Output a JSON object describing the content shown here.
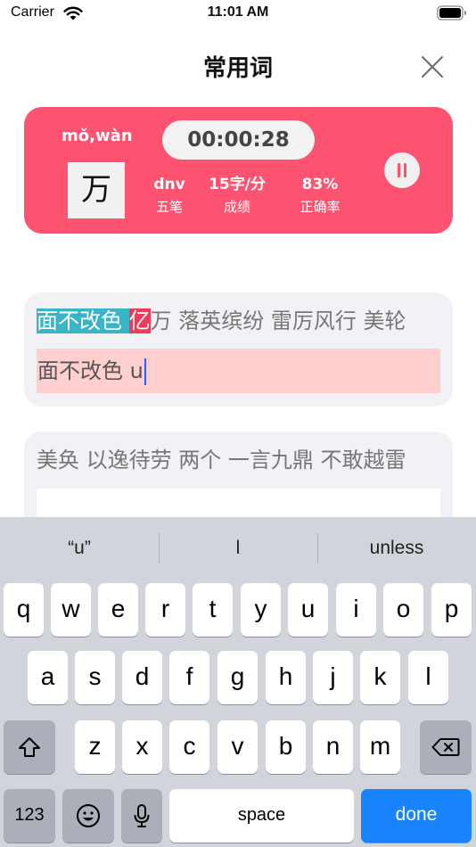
{
  "status_bar": {
    "carrier": "Carrier",
    "time": "11:01 AM"
  },
  "nav": {
    "title": "常用词"
  },
  "stats": {
    "pinyin": "mǒ,wàn",
    "character": "万",
    "timer": "00:00:28",
    "code": {
      "value": "dnv",
      "label": "五笔"
    },
    "speed": {
      "value": "15字/分",
      "label": "成绩"
    },
    "accuracy": {
      "value": "83%",
      "label": "正确率"
    },
    "accent_color": "#fd5370"
  },
  "practice": {
    "typed_correct": "面不改色",
    "typed_space": " ",
    "typed_error": "亿",
    "remaining": "万 落英缤纷 雷厉风行 美轮",
    "input_text": "面不改色 u",
    "correct_color": "#3ab4c7",
    "error_color": "#f03a5a"
  },
  "next_line": {
    "text": "美奂 以逸待劳 两个 一言九鼎 不敢越雷"
  },
  "keyboard": {
    "suggestions": [
      "“u”",
      "l",
      "unless"
    ],
    "row1": [
      "q",
      "w",
      "e",
      "r",
      "t",
      "y",
      "u",
      "i",
      "o",
      "p"
    ],
    "row2": [
      "a",
      "s",
      "d",
      "f",
      "g",
      "h",
      "j",
      "k",
      "l"
    ],
    "row3": [
      "z",
      "x",
      "c",
      "v",
      "b",
      "n",
      "m"
    ],
    "numbers_label": "123",
    "space_label": "space",
    "done_label": "done"
  }
}
